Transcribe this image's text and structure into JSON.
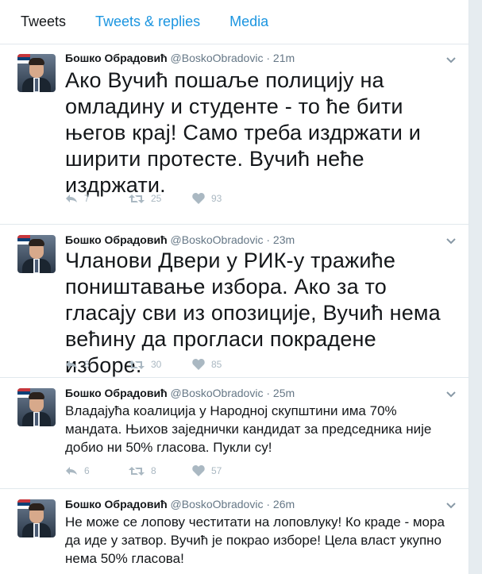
{
  "tabs": [
    {
      "label": "Tweets"
    },
    {
      "label": "Tweets & replies"
    },
    {
      "label": "Media"
    }
  ],
  "tweets": [
    {
      "name": "Бошко Обрадовић",
      "handle": "@BoskoObradovic",
      "sep": "·",
      "time": "21m",
      "text": "Ако Вучић пошаље полицију на омладину и студенте - то ће бити његов крај! Само треба издржати и ширити протесте. Вучић неће издржати.",
      "replies": "7",
      "retweets": "25",
      "likes": "93"
    },
    {
      "name": "Бошко Обрадовић",
      "handle": "@BoskoObradovic",
      "sep": "·",
      "time": "23m",
      "text": "Чланови Двери у РИК-у тражиће поништавање избора. Ако за то гласају сви из опозиције, Вучић нема већину да прогласи покрадене изборе.",
      "replies": "8",
      "retweets": "30",
      "likes": "85"
    },
    {
      "name": "Бошко Обрадовић",
      "handle": "@BoskoObradovic",
      "sep": "·",
      "time": "25m",
      "text": "Владајућа коалиција у Народној скупштини има 70% мандата. Њихов заједнички кандидат за председника није добио ни 50% гласова. Пукли су!",
      "replies": "6",
      "retweets": "8",
      "likes": "57"
    },
    {
      "name": "Бошко Обрадовић",
      "handle": "@BoskoObradovic",
      "sep": "·",
      "time": "26m",
      "text": "Не може се лопову честитати на лоповлуку! Ко краде - мора да иде у затвор. Вучић је покрао изборе! Цела власт укупно нема 50% гласова!"
    }
  ]
}
